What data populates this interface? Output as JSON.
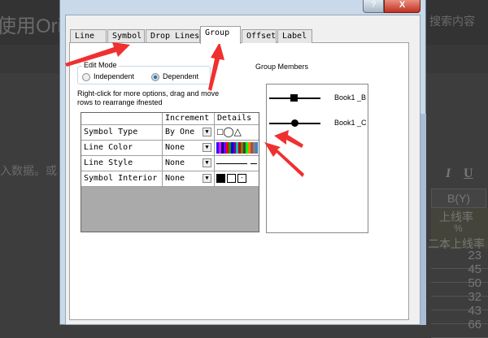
{
  "background": {
    "heading": "使用Ori",
    "search": "搜索内容",
    "body_text": "入数据。或",
    "toolbar": {
      "italic": "I",
      "underline": "U"
    },
    "sheet": {
      "column": "B(Y)",
      "long_name": "上线率",
      "units": "%",
      "comment": "二本上线率",
      "values": [
        "23",
        "45",
        "50",
        "32",
        "43",
        "66"
      ]
    }
  },
  "dialog": {
    "help": "?",
    "close": "X",
    "tabs": [
      "Line",
      "Symbol",
      "Drop Lines",
      "Group",
      "Offset",
      "Label"
    ],
    "active_tab": "Group",
    "edit_mode": {
      "label": "Edit Mode",
      "options": [
        "Independent",
        "Dependent"
      ],
      "selected": "Dependent"
    },
    "hint": "Right-click for more options, drag and move rows to  rearrange ifnested",
    "table": {
      "headers": [
        "",
        "Increment",
        "Details"
      ],
      "rows": [
        {
          "name": "Symbol Type",
          "increment": "By One"
        },
        {
          "name": "Line Color",
          "increment": "None"
        },
        {
          "name": "Line Style",
          "increment": "None"
        },
        {
          "name": "Symbol Interior",
          "increment": "None"
        }
      ]
    },
    "group_members": {
      "label": "Group Members",
      "items": [
        {
          "name": "Book1 _B",
          "symbol": "square"
        },
        {
          "name": "Book1 _C",
          "symbol": "circle"
        }
      ]
    },
    "color_strip": [
      "#1a1aff",
      "#ff00ff",
      "#000080",
      "#7f00ff",
      "#ff0000",
      "#00a000",
      "#0000ff",
      "#800080",
      "#00c0c0",
      "#c00000",
      "#808000",
      "#404040",
      "#00ff00",
      "#ff8000",
      "#a05050",
      "#808080",
      "#4080c0"
    ]
  }
}
